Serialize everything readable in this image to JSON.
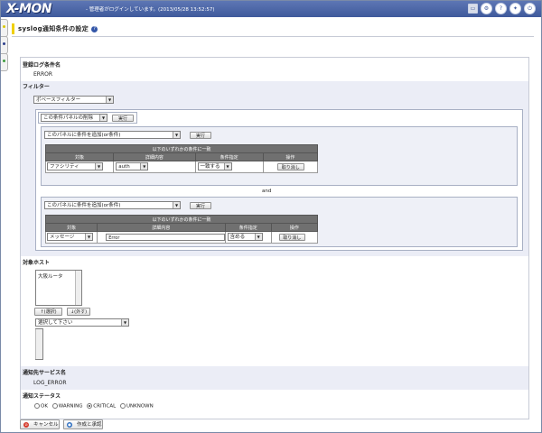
{
  "header": {
    "logo": "X-MON",
    "message": "- 管理者がログインしています。(2013/05/28 13:52:57)",
    "icons": [
      "gear-icon",
      "help-icon",
      "lock-icon",
      "logout-icon"
    ]
  },
  "page": {
    "title": "syslog通知条件の設定"
  },
  "condition_name": {
    "label": "登録ログ条件名",
    "value": "ERROR"
  },
  "filter": {
    "label": "フィルター",
    "type_select": "ボベースフィルター",
    "panel_action_select": "この条件パネルの削除",
    "run_label": "実行",
    "and_label": "and",
    "panels": [
      {
        "add_select": "このパネルに条件を追加(or条件)",
        "run_label": "実行",
        "caption": "以下のいずれかの条件に一致",
        "headers": [
          "対象",
          "詳細内容",
          "条件指定",
          "操作"
        ],
        "row": {
          "target": "ファシリティ",
          "detail": "auth",
          "cond": "一致する",
          "action": "取り消し"
        }
      },
      {
        "add_select": "このパネルに条件を追加(or条件)",
        "run_label": "実行",
        "caption": "以下のいずれかの条件に一致",
        "headers": [
          "対象",
          "詳細内容",
          "条件指定",
          "操作"
        ],
        "row": {
          "target": "メッセージ",
          "detail": "Error",
          "cond": "含める",
          "action": "取り消し"
        }
      }
    ]
  },
  "hosts": {
    "label": "対象ホスト",
    "selected_item": "大阪ルータ",
    "select_btn": "↑(選択)",
    "remove_btn": "↓(外す)",
    "placeholder_select": "選択して下さい"
  },
  "service": {
    "label": "通知先サービス名",
    "value": "LOG_ERROR"
  },
  "status": {
    "label": "通知ステータス",
    "options": [
      "OK",
      "WARNING",
      "CRITICAL",
      "UNKNOWN"
    ],
    "selected": "CRITICAL"
  },
  "footer": {
    "cancel_label": "キャンセル",
    "submit_label": "作成と承認"
  },
  "colors": {
    "header": "#4d67a8",
    "section_bg": "#ebedf6",
    "accent": "#f0d000"
  }
}
